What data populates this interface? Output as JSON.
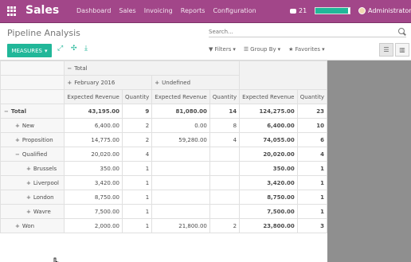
{
  "navbar": {
    "brand": "Sales",
    "menu": [
      "Dashboard",
      "Sales",
      "Invoicing",
      "Reports",
      "Configuration"
    ],
    "chat_count": "21",
    "progress_fraction": 0.95,
    "user": "Administrator"
  },
  "panel": {
    "title": "Pipeline Analysis",
    "search_placeholder": "Search...",
    "measures_label": "MEASURES",
    "filters_label": "Filters",
    "groupby_label": "Group By",
    "favorites_label": "Favorites"
  },
  "pivot": {
    "col_total_label": "Total",
    "col_groups": [
      "February 2016",
      "Undefined"
    ],
    "measure_labels": [
      "Expected Revenue",
      "Quantity"
    ],
    "rows": [
      {
        "label": "Total",
        "indent": 0,
        "sign": "−",
        "cells": [
          "43,195.00",
          "9",
          "81,080.00",
          "14",
          "124,275.00",
          "23"
        ],
        "bold": true
      },
      {
        "label": "New",
        "indent": 1,
        "sign": "+",
        "cells": [
          "6,400.00",
          "2",
          "0.00",
          "8",
          "6,400.00",
          "10"
        ]
      },
      {
        "label": "Proposition",
        "indent": 1,
        "sign": "+",
        "cells": [
          "14,775.00",
          "2",
          "59,280.00",
          "4",
          "74,055.00",
          "6"
        ]
      },
      {
        "label": "Qualified",
        "indent": 1,
        "sign": "−",
        "cells": [
          "20,020.00",
          "4",
          "",
          "",
          "20,020.00",
          "4"
        ]
      },
      {
        "label": "Brussels",
        "indent": 2,
        "sign": "+",
        "cells": [
          "350.00",
          "1",
          "",
          "",
          "350.00",
          "1"
        ]
      },
      {
        "label": "Liverpool",
        "indent": 2,
        "sign": "+",
        "cells": [
          "3,420.00",
          "1",
          "",
          "",
          "3,420.00",
          "1"
        ]
      },
      {
        "label": "London",
        "indent": 2,
        "sign": "+",
        "cells": [
          "8,750.00",
          "1",
          "",
          "",
          "8,750.00",
          "1"
        ]
      },
      {
        "label": "Wavre",
        "indent": 2,
        "sign": "+",
        "cells": [
          "7,500.00",
          "1",
          "",
          "",
          "7,500.00",
          "1"
        ]
      },
      {
        "label": "Won",
        "indent": 1,
        "sign": "+",
        "cells": [
          "2,000.00",
          "1",
          "21,800.00",
          "2",
          "23,800.00",
          "3"
        ]
      }
    ]
  },
  "icons": [
    "apps-icon",
    "chat-icon",
    "avatar-icon",
    "search-icon",
    "expand-icon",
    "swap-axis-icon",
    "download-icon",
    "list-view-icon",
    "graph-view-icon"
  ]
}
